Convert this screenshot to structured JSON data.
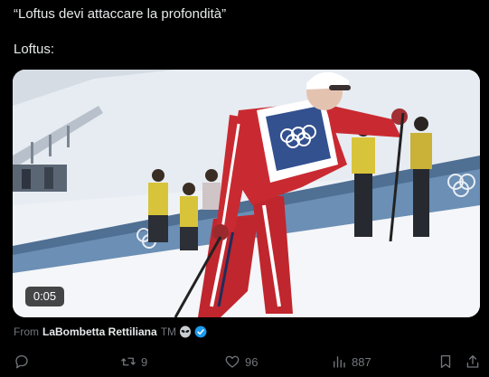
{
  "post": {
    "line1": "“Loftus devi attaccare la profondità”",
    "line2": "Loftus:"
  },
  "video": {
    "timestamp": "0:05"
  },
  "source": {
    "prefix": "From",
    "name": "LaBombetta Rettiliana",
    "suffix": "TM"
  },
  "actions": {
    "replies": "",
    "reposts": "9",
    "likes": "96",
    "views": "887"
  },
  "colors": {
    "background": "#000000",
    "text": "#e7e9ea",
    "muted": "#71767b",
    "verified": "#1d9bf0"
  },
  "icons": [
    "reply-icon",
    "repost-icon",
    "like-icon",
    "views-icon",
    "bookmark-icon",
    "share-icon",
    "alien-icon",
    "verified-badge-icon"
  ]
}
